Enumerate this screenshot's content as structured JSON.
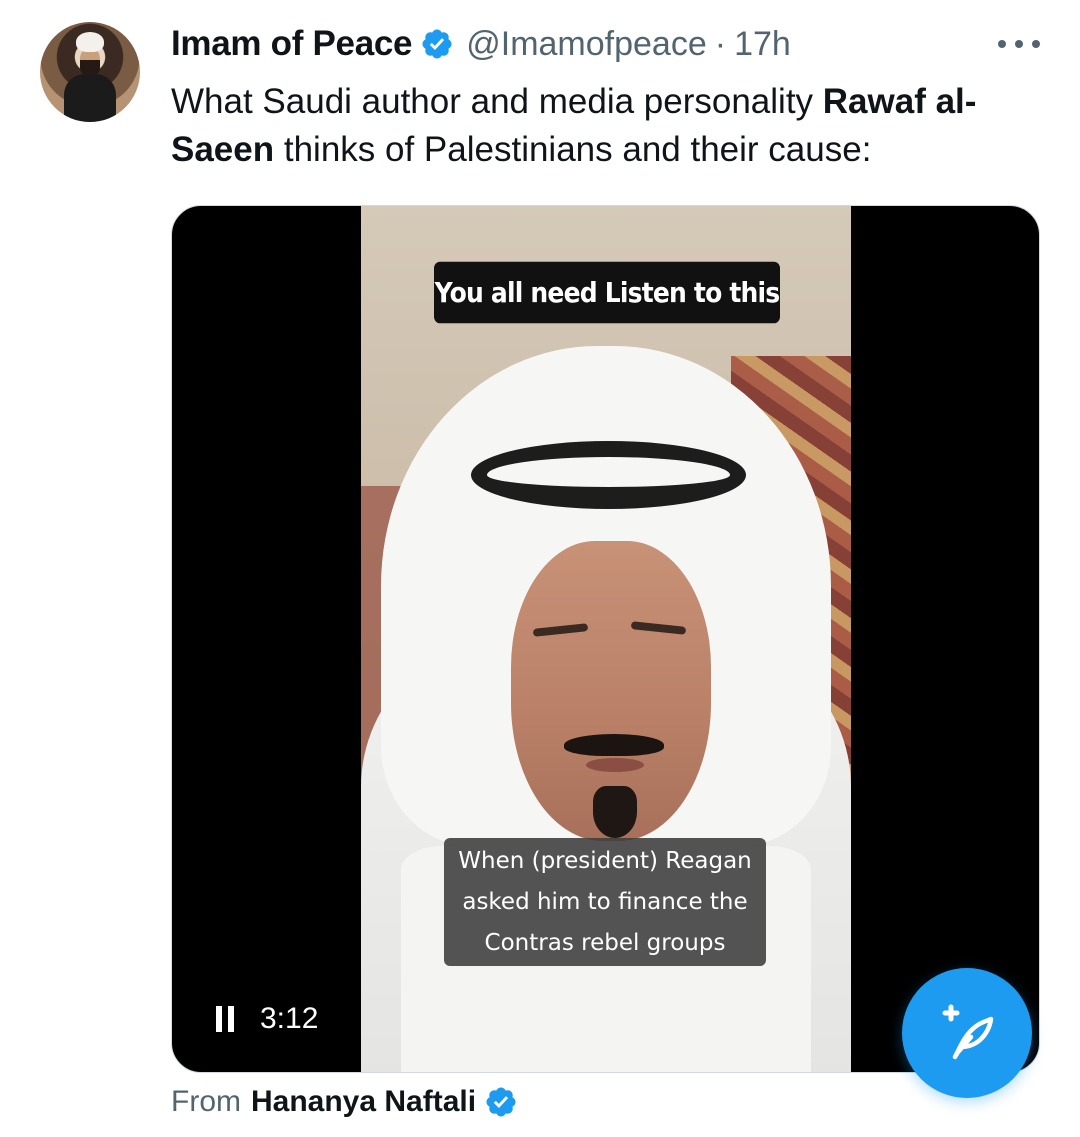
{
  "tweet": {
    "author_name": "Imam of Peace",
    "handle": "@Imamofpeace",
    "separator": "·",
    "time": "17h",
    "text_part1": "What Saudi author and media personality ",
    "text_bold1": "Rawaf al-Saeen",
    "text_part2": " thinks of Palestinians and their cause:"
  },
  "video": {
    "caption_top": "You all need Listen to this",
    "caption_bottom_lines": [
      "When (president) Reagan",
      "asked him to finance the",
      "Contras rebel groups"
    ],
    "duration": "3:12",
    "state_icon": "pause-icon"
  },
  "attribution": {
    "prefix": "From",
    "source_name": "Hananya Naftali"
  },
  "icons": {
    "verified": "verified-badge-icon",
    "more": "more-horizontal-icon",
    "compose": "compose-tweet-icon"
  },
  "colors": {
    "accent": "#1d9bf0",
    "secondary_text": "#536471",
    "primary_text": "#0f1419"
  }
}
